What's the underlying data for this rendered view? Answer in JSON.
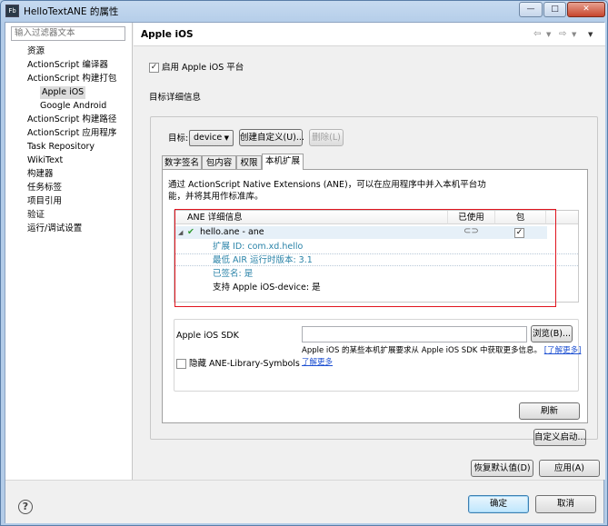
{
  "window": {
    "title": "HelloTextANE 的属性",
    "app_icon_text": "Fb",
    "controls": {
      "minimize": "—",
      "maximize": "□",
      "close": "✕"
    }
  },
  "sidebar": {
    "filter_placeholder": "输入过滤器文本",
    "items": [
      {
        "label": "资源",
        "level": 0
      },
      {
        "label": "ActionScript 编译器",
        "level": 0
      },
      {
        "label": "ActionScript 构建打包",
        "level": 0
      },
      {
        "label": "Apple iOS",
        "level": 1,
        "selected": true
      },
      {
        "label": "Google Android",
        "level": 1
      },
      {
        "label": "ActionScript 构建路径",
        "level": 0
      },
      {
        "label": "ActionScript 应用程序",
        "level": 0
      },
      {
        "label": "Task Repository",
        "level": 0
      },
      {
        "label": "WikiText",
        "level": 0
      },
      {
        "label": "构建器",
        "level": 0
      },
      {
        "label": "任务标签",
        "level": 0
      },
      {
        "label": "项目引用",
        "level": 0
      },
      {
        "label": "验证",
        "level": 0
      },
      {
        "label": "运行/调试设置",
        "level": 0
      }
    ]
  },
  "page": {
    "title": "Apple iOS",
    "enable_platform": {
      "label": "启用 Apple iOS 平台",
      "checked": true
    },
    "target_details_label": "目标详细信息",
    "target": {
      "label": "目标:",
      "selected": "device",
      "create_custom_button": "创建自定义(U)...",
      "delete_button": "删除(L)"
    },
    "tabs": [
      "数字签名",
      "包内容",
      "权限",
      "本机扩展"
    ],
    "active_tab": "本机扩展",
    "extension_description": "通过 ActionScript Native Extensions (ANE)，可以在应用程序中并入本机平台功能，并将其用作标准库。",
    "table": {
      "headers": [
        "ANE 详细信息",
        "已使用",
        "包"
      ],
      "root": {
        "label": "hello.ane - ane",
        "used_icon": "link-icon",
        "packaged": true
      },
      "details": [
        {
          "label": "扩展 ID: com.xd.hello",
          "color": "blue"
        },
        {
          "label": "最低 AIR 运行时版本: 3.1",
          "color": "blue"
        },
        {
          "label": "已签名: 是",
          "color": "blue"
        },
        {
          "label": "支持 Apple iOS-device: 是",
          "color": "black"
        }
      ]
    },
    "sdk": {
      "label": "Apple iOS SDK",
      "value": "",
      "browse_button": "浏览(B)...",
      "hint": "Apple iOS 的某些本机扩展要求从 Apple iOS SDK 中获取更多信息。",
      "learn_more": "了解更多",
      "hide_symbols": {
        "label": "隐藏 ANE-Library-Symbols",
        "checked": false
      }
    },
    "refresh_button": "刷新",
    "custom_launch_button": "自定义启动...",
    "restore_defaults_button": "恢复默认值(D)",
    "apply_button": "应用(A)"
  },
  "footer": {
    "help_icon": "?",
    "ok_button": "确定",
    "cancel_button": "取消"
  }
}
